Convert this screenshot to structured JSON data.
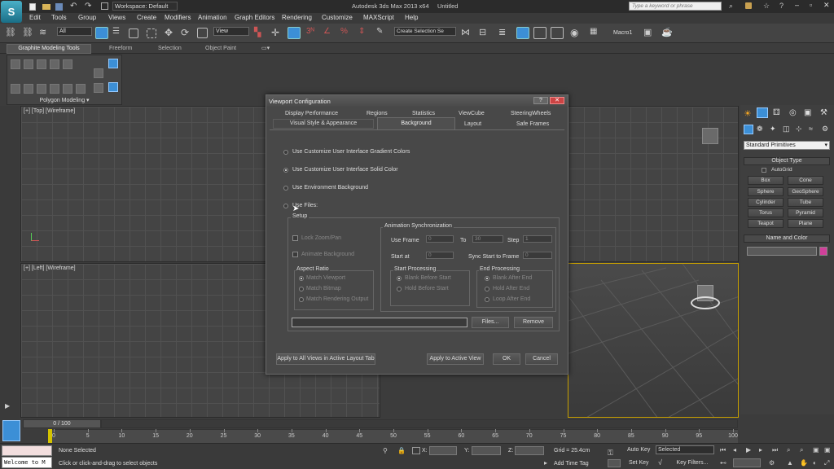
{
  "app": {
    "title": "Autodesk 3ds Max  2013 x64",
    "file": "Untitled",
    "workspace": "Workspace: Default",
    "search_placeholder": "Type a keyword or phrase"
  },
  "menu": [
    "Edit",
    "Tools",
    "Group",
    "Views",
    "Create",
    "Modifiers",
    "Animation",
    "Graph Editors",
    "Rendering",
    "Customize",
    "MAXScript",
    "Help"
  ],
  "toolbar": {
    "selection_filter": "All",
    "reference_coord": "View",
    "named_selection": "Create Selection Se",
    "macro": "Macro1"
  },
  "ribbon": {
    "tabs": [
      "Graphite Modeling Tools",
      "Freeform",
      "Selection",
      "Object Paint"
    ],
    "panel_label": "Polygon Modeling"
  },
  "viewports": {
    "top_label": "[+] [Top] [Wireframe]",
    "left_label": "[+] [Left] [Wireframe]"
  },
  "dialog": {
    "title": "Viewport Configuration",
    "tabs_row1": [
      "Display Performance",
      "Regions",
      "Statistics",
      "ViewCube",
      "SteeringWheels"
    ],
    "tabs_row2": [
      "Visual Style & Appearance",
      "Background",
      "Layout",
      "Safe Frames"
    ],
    "options": [
      {
        "label": "Use Customize User Interface Gradient Colors",
        "selected": false
      },
      {
        "label": "Use Customize User Interface Solid Color",
        "selected": true
      },
      {
        "label": "Use Environment Background",
        "selected": false
      },
      {
        "label": "Use Files:",
        "selected": false
      }
    ],
    "setup_label": "Setup",
    "lock_zoom_pan": "Lock Zoom/Pan",
    "animate_background": "Animate Background",
    "aspect_ratio": {
      "label": "Aspect Ratio",
      "options": [
        "Match Viewport",
        "Match Bitmap",
        "Match Rendering Output"
      ],
      "selected": 0
    },
    "anim_sync": {
      "label": "Animation Synchronization",
      "use_frame": "Use Frame",
      "use_frame_value": "0",
      "to": "To",
      "to_value": "30",
      "step": "Step",
      "step_value": "1",
      "start_at": "Start at",
      "start_at_value": "0",
      "sync_start": "Sync Start to Frame",
      "sync_start_value": "0"
    },
    "start_processing": {
      "label": "Start Processing",
      "options": [
        "Blank Before Start",
        "Hold Before Start"
      ],
      "selected": 0
    },
    "end_processing": {
      "label": "End Processing",
      "options": [
        "Blank After End",
        "Hold After End",
        "Loop After End"
      ],
      "selected": 0
    },
    "files_button": "Files...",
    "remove_button": "Remove",
    "apply_all": "Apply to All Views in Active Layout Tab",
    "apply_active": "Apply to Active View",
    "ok": "OK",
    "cancel": "Cancel"
  },
  "command_panel": {
    "category": "Standard Primitives",
    "object_type_header": "Object Type",
    "autogrid": "AutoGrid",
    "primitives": [
      "Box",
      "Cone",
      "Sphere",
      "GeoSphere",
      "Cylinder",
      "Tube",
      "Torus",
      "Pyramid",
      "Teapot",
      "Plane"
    ],
    "name_color_header": "Name and Color"
  },
  "timeline": {
    "frame_counter": "0 / 100",
    "ticks": [
      "0",
      "5",
      "10",
      "15",
      "20",
      "25",
      "30",
      "35",
      "40",
      "45",
      "50",
      "55",
      "60",
      "65",
      "70",
      "75",
      "80",
      "85",
      "90",
      "95",
      "100"
    ]
  },
  "status": {
    "listener": "Welcome to M",
    "none_selected": "None Selected",
    "prompt": "Click or click-and-drag to select objects",
    "x_label": "X:",
    "y_label": "Y:",
    "z_label": "Z:",
    "grid": "Grid = 25.4cm",
    "add_time_tag": "Add Time Tag",
    "auto_key": "Auto Key",
    "set_key": "Set Key",
    "key_mode": "Selected",
    "key_filters": "Key Filters..."
  },
  "colors": {
    "accent_blue": "#3c8fd6",
    "object_color": "#d0409a"
  }
}
